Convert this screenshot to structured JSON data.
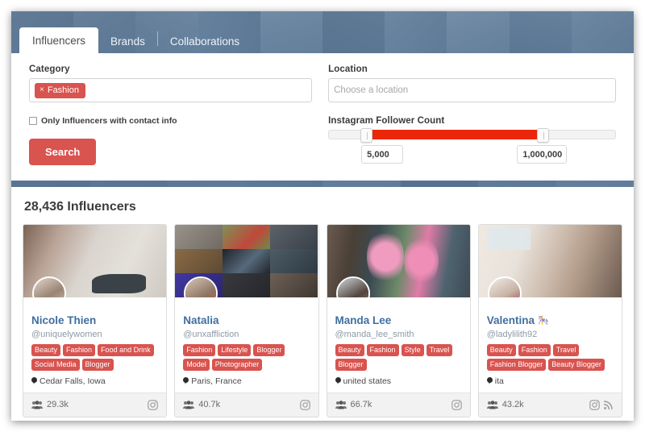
{
  "header": {
    "tabs": [
      {
        "label": "Influencers",
        "active": true
      },
      {
        "label": "Brands",
        "active": false
      },
      {
        "label": "Collaborations",
        "active": false
      }
    ]
  },
  "search": {
    "category": {
      "label": "Category",
      "tokens": [
        {
          "text": "Fashion",
          "remove": "×"
        }
      ]
    },
    "contact_only": {
      "label": "Only Influencers with contact info",
      "checked": false
    },
    "search_button": "Search",
    "location": {
      "label": "Location",
      "placeholder": "Choose a location",
      "value": ""
    },
    "follower_count": {
      "label": "Instagram Follower Count",
      "min_value": "5,000",
      "max_value": "1,000,000"
    }
  },
  "results": {
    "count_title": "28,436 Influencers",
    "cards": [
      {
        "name": "Nicole Thien",
        "emoji": "",
        "handle": "@uniquelywomen",
        "tags": [
          "Beauty",
          "Fashion",
          "Food and Drink",
          "Social Media",
          "Blogger"
        ],
        "location": "Cedar Falls, Iowa",
        "followers": "29.3k",
        "social": [
          "instagram"
        ],
        "cover_style": "photo",
        "cover_colors": [
          "#cbb8ab",
          "#ded8d2",
          "#b8a597",
          "#e3ded7"
        ],
        "avatar_color": "#c9bbb0"
      },
      {
        "name": "Natalia",
        "emoji": "",
        "handle": "@unxaffliction",
        "tags": [
          "Fashion",
          "Lifestyle",
          "Blogger",
          "Model",
          "Photographer"
        ],
        "location": "Paris, France",
        "followers": "40.7k",
        "social": [
          "instagram"
        ],
        "cover_style": "grid",
        "cover_colors": [
          "#8b8b86",
          "#6d8a52",
          "#52585c",
          "#7a6a4e",
          "#2b2b2f",
          "#47565f",
          "#3b3a38",
          "#2d3136",
          "#5a4f4a"
        ],
        "avatar_color": "#a08d7d"
      },
      {
        "name": "Manda Lee",
        "emoji": "",
        "handle": "@manda_lee_smith",
        "tags": [
          "Beauty",
          "Fashion",
          "Style",
          "Travel",
          "Blogger"
        ],
        "location": "united states",
        "followers": "66.7k",
        "social": [
          "instagram"
        ],
        "cover_style": "photo",
        "cover_colors": [
          "#6b5f58",
          "#3f5460",
          "#d98ab0",
          "#5e7b66"
        ],
        "avatar_color": "#7b6a60"
      },
      {
        "name": "Valentina",
        "emoji": "🎠",
        "handle": "@ladylilith92",
        "tags": [
          "Beauty",
          "Fashion",
          "Travel",
          "Fashion Blogger",
          "Beauty Blogger"
        ],
        "location": "ita",
        "followers": "43.2k",
        "social": [
          "instagram",
          "rss"
        ],
        "cover_style": "photo",
        "cover_colors": [
          "#e6ded6",
          "#cdbdb0",
          "#d8cfc6",
          "#b9a798"
        ],
        "avatar_color": "#d5c8bd"
      }
    ]
  },
  "colors": {
    "brand_red": "#d9534f",
    "slider_red": "#ea2708",
    "header_blue": "#5b7fa6",
    "name_blue": "#3f6fa0"
  }
}
